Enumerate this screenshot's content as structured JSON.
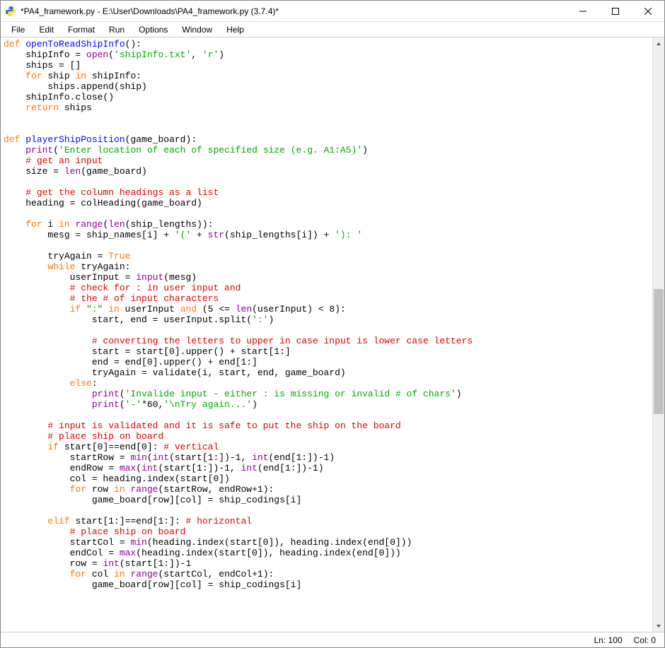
{
  "window": {
    "title": "*PA4_framework.py - E:\\User\\Downloads\\PA4_framework.py (3.7.4)*"
  },
  "menu": {
    "items": [
      "File",
      "Edit",
      "Format",
      "Run",
      "Options",
      "Window",
      "Help"
    ]
  },
  "status": {
    "line": "Ln: 100",
    "col": "Col: 0"
  },
  "scrollbar": {
    "thumb_top_pct": 42,
    "thumb_height_pct": 22
  },
  "code": {
    "tokens": [
      [
        [
          "kw",
          "def"
        ],
        [
          "txt",
          " "
        ],
        [
          "fn",
          "openToReadShipInfo"
        ],
        [
          "txt",
          "():"
        ]
      ],
      [
        [
          "txt",
          "    shipInfo = "
        ],
        [
          "bi",
          "open"
        ],
        [
          "txt",
          "("
        ],
        [
          "str",
          "'shipInfo.txt'"
        ],
        [
          "txt",
          ", "
        ],
        [
          "str",
          "'r'"
        ],
        [
          "txt",
          ")"
        ]
      ],
      [
        [
          "txt",
          "    ships = []"
        ]
      ],
      [
        [
          "txt",
          "    "
        ],
        [
          "kw",
          "for"
        ],
        [
          "txt",
          " ship "
        ],
        [
          "kw",
          "in"
        ],
        [
          "txt",
          " shipInfo:"
        ]
      ],
      [
        [
          "txt",
          "        ships.append(ship)"
        ]
      ],
      [
        [
          "txt",
          "    shipInfo.close()"
        ]
      ],
      [
        [
          "txt",
          "    "
        ],
        [
          "kw",
          "return"
        ],
        [
          "txt",
          " ships"
        ]
      ],
      [
        [
          "txt",
          ""
        ]
      ],
      [
        [
          "txt",
          ""
        ]
      ],
      [
        [
          "kw",
          "def"
        ],
        [
          "txt",
          " "
        ],
        [
          "fn",
          "playerShipPosition"
        ],
        [
          "txt",
          "(game_board):"
        ]
      ],
      [
        [
          "txt",
          "    "
        ],
        [
          "bi",
          "print"
        ],
        [
          "txt",
          "("
        ],
        [
          "str",
          "'Enter location of each of specified size (e.g. A1:A5)'"
        ],
        [
          "txt",
          ")"
        ]
      ],
      [
        [
          "txt",
          "    "
        ],
        [
          "cm",
          "# get an input"
        ]
      ],
      [
        [
          "txt",
          "    size = "
        ],
        [
          "bi",
          "len"
        ],
        [
          "txt",
          "(game_board)"
        ]
      ],
      [
        [
          "txt",
          ""
        ]
      ],
      [
        [
          "txt",
          "    "
        ],
        [
          "cm",
          "# get the column headings as a list"
        ]
      ],
      [
        [
          "txt",
          "    heading = colHeading(game_board)"
        ]
      ],
      [
        [
          "txt",
          ""
        ]
      ],
      [
        [
          "txt",
          "    "
        ],
        [
          "kw",
          "for"
        ],
        [
          "txt",
          " i "
        ],
        [
          "kw",
          "in"
        ],
        [
          "txt",
          " "
        ],
        [
          "bi",
          "range"
        ],
        [
          "txt",
          "("
        ],
        [
          "bi",
          "len"
        ],
        [
          "txt",
          "(ship_lengths)):"
        ]
      ],
      [
        [
          "txt",
          "        mesg = ship_names[i] + "
        ],
        [
          "str",
          "'('"
        ],
        [
          "txt",
          " + "
        ],
        [
          "bi",
          "str"
        ],
        [
          "txt",
          "(ship_lengths[i]) + "
        ],
        [
          "str",
          "'): '"
        ]
      ],
      [
        [
          "txt",
          ""
        ]
      ],
      [
        [
          "txt",
          "        tryAgain = "
        ],
        [
          "kw",
          "True"
        ]
      ],
      [
        [
          "txt",
          "        "
        ],
        [
          "kw",
          "while"
        ],
        [
          "txt",
          " tryAgain:"
        ]
      ],
      [
        [
          "txt",
          "            userInput = "
        ],
        [
          "bi",
          "input"
        ],
        [
          "txt",
          "(mesg)"
        ]
      ],
      [
        [
          "txt",
          "            "
        ],
        [
          "cm",
          "# check for : in user input and"
        ]
      ],
      [
        [
          "txt",
          "            "
        ],
        [
          "cm",
          "# the # of input characters"
        ]
      ],
      [
        [
          "txt",
          "            "
        ],
        [
          "kw",
          "if"
        ],
        [
          "txt",
          " "
        ],
        [
          "str",
          "\":\""
        ],
        [
          "txt",
          " "
        ],
        [
          "kw",
          "in"
        ],
        [
          "txt",
          " userInput "
        ],
        [
          "kw",
          "and"
        ],
        [
          "txt",
          " (5 <= "
        ],
        [
          "bi",
          "len"
        ],
        [
          "txt",
          "(userInput) < 8):"
        ]
      ],
      [
        [
          "txt",
          "                start, end = userInput.split("
        ],
        [
          "str",
          "':'"
        ],
        [
          "txt",
          ")"
        ]
      ],
      [
        [
          "txt",
          ""
        ]
      ],
      [
        [
          "txt",
          "                "
        ],
        [
          "cm",
          "# converting the letters to upper in case input is lower case letters"
        ]
      ],
      [
        [
          "txt",
          "                start = start[0].upper() + start[1:]"
        ]
      ],
      [
        [
          "txt",
          "                end = end[0].upper() + end[1:]"
        ]
      ],
      [
        [
          "txt",
          "                tryAgain = validate(i, start, end, game_board)"
        ]
      ],
      [
        [
          "txt",
          "            "
        ],
        [
          "kw",
          "else"
        ],
        [
          "txt",
          ":"
        ]
      ],
      [
        [
          "txt",
          "                "
        ],
        [
          "bi",
          "print"
        ],
        [
          "txt",
          "("
        ],
        [
          "str",
          "'Invalide input - either : is missing or invalid # of chars'"
        ],
        [
          "txt",
          ")"
        ]
      ],
      [
        [
          "txt",
          "                "
        ],
        [
          "bi",
          "print"
        ],
        [
          "txt",
          "("
        ],
        [
          "str",
          "'-'"
        ],
        [
          "txt",
          "*60,"
        ],
        [
          "str",
          "'\\nTry again...'"
        ],
        [
          "txt",
          ")"
        ]
      ],
      [
        [
          "txt",
          ""
        ]
      ],
      [
        [
          "txt",
          "        "
        ],
        [
          "cm",
          "# input is validated and it is safe to put the ship on the board"
        ]
      ],
      [
        [
          "txt",
          "        "
        ],
        [
          "cm",
          "# place ship on board"
        ]
      ],
      [
        [
          "txt",
          "        "
        ],
        [
          "kw",
          "if"
        ],
        [
          "txt",
          " start[0]==end[0]: "
        ],
        [
          "cm",
          "# vertical"
        ]
      ],
      [
        [
          "txt",
          "            startRow = "
        ],
        [
          "bi",
          "min"
        ],
        [
          "txt",
          "("
        ],
        [
          "bi",
          "int"
        ],
        [
          "txt",
          "(start[1:])-1, "
        ],
        [
          "bi",
          "int"
        ],
        [
          "txt",
          "(end[1:])-1)"
        ]
      ],
      [
        [
          "txt",
          "            endRow = "
        ],
        [
          "bi",
          "max"
        ],
        [
          "txt",
          "("
        ],
        [
          "bi",
          "int"
        ],
        [
          "txt",
          "(start[1:])-1, "
        ],
        [
          "bi",
          "int"
        ],
        [
          "txt",
          "(end[1:])-1)"
        ]
      ],
      [
        [
          "txt",
          "            col = heading.index(start[0])"
        ]
      ],
      [
        [
          "txt",
          "            "
        ],
        [
          "kw",
          "for"
        ],
        [
          "txt",
          " row "
        ],
        [
          "kw",
          "in"
        ],
        [
          "txt",
          " "
        ],
        [
          "bi",
          "range"
        ],
        [
          "txt",
          "(startRow, endRow+1):"
        ]
      ],
      [
        [
          "txt",
          "                game_board[row][col] = ship_codings[i]"
        ]
      ],
      [
        [
          "txt",
          ""
        ]
      ],
      [
        [
          "txt",
          "        "
        ],
        [
          "kw",
          "elif"
        ],
        [
          "txt",
          " start[1:]==end[1:]: "
        ],
        [
          "cm",
          "# horizontal"
        ]
      ],
      [
        [
          "txt",
          "            "
        ],
        [
          "cm",
          "# place ship on board"
        ]
      ],
      [
        [
          "txt",
          "            startCol = "
        ],
        [
          "bi",
          "min"
        ],
        [
          "txt",
          "(heading.index(start[0]), heading.index(end[0]))"
        ]
      ],
      [
        [
          "txt",
          "            endCol = "
        ],
        [
          "bi",
          "max"
        ],
        [
          "txt",
          "(heading.index(start[0]), heading.index(end[0]))"
        ]
      ],
      [
        [
          "txt",
          "            row = "
        ],
        [
          "bi",
          "int"
        ],
        [
          "txt",
          "(start[1:])-1"
        ]
      ],
      [
        [
          "txt",
          "            "
        ],
        [
          "kw",
          "for"
        ],
        [
          "txt",
          " col "
        ],
        [
          "kw",
          "in"
        ],
        [
          "txt",
          " "
        ],
        [
          "bi",
          "range"
        ],
        [
          "txt",
          "(startCol, endCol+1):"
        ]
      ],
      [
        [
          "txt",
          "                game_board[row][col] = ship_codings[i]"
        ]
      ]
    ]
  }
}
